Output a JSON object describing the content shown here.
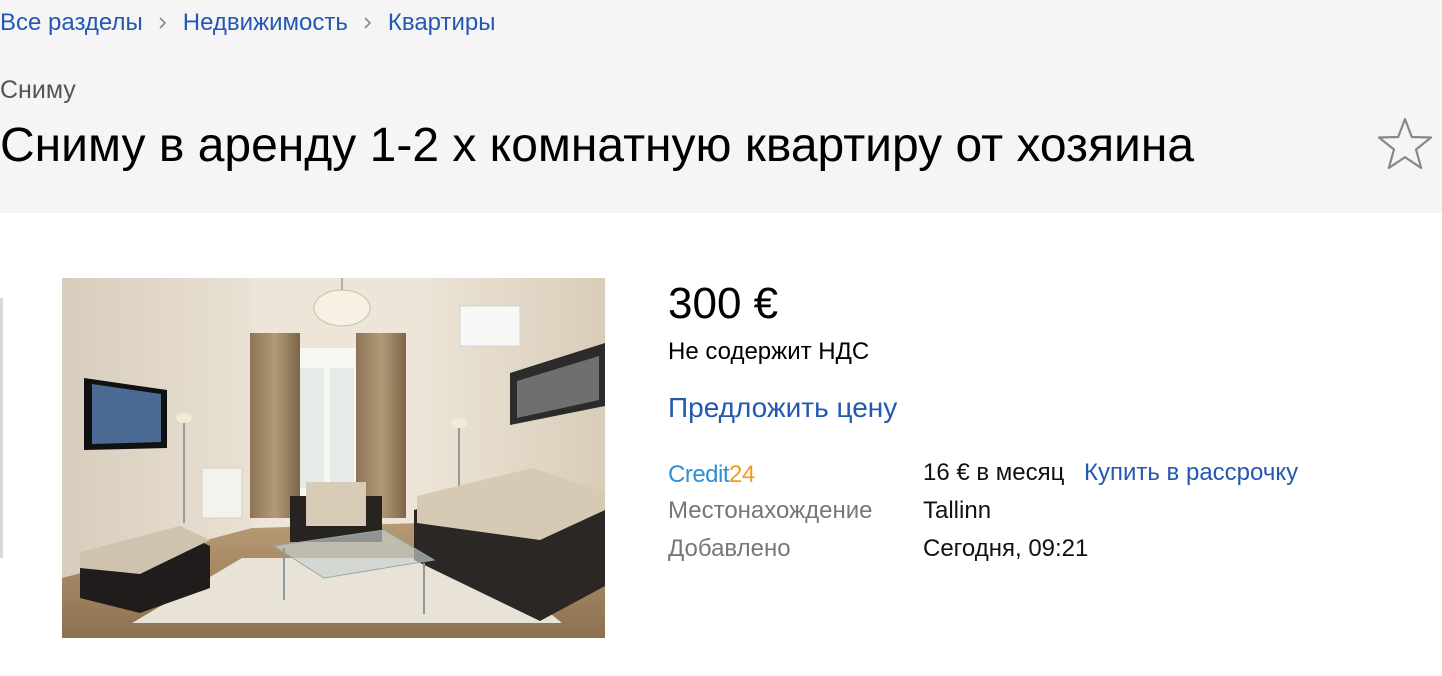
{
  "breadcrumb": [
    "Все разделы",
    "Недвижимость",
    "Квартиры"
  ],
  "category": "Сниму",
  "title": "Сниму в аренду 1-2 х комнатную квартиру от хозяина",
  "price": "300 €",
  "vat_note": "Не содержит НДС",
  "offer_price": "Предложить цену",
  "credit": {
    "logo_text": "Credit24",
    "monthly": "16 € в месяц",
    "buy_link": "Купить в рассрочку"
  },
  "details": [
    {
      "label": "Местонахождение",
      "value": "Tallinn"
    },
    {
      "label": "Добавлено",
      "value": "Сегодня, 09:21"
    }
  ],
  "colors": {
    "link": "#2458b3",
    "header_bg": "#f5f5f5",
    "credit_blue": "#2f8fd3",
    "credit_orange": "#f39a1e"
  },
  "icons": {
    "favorite": "star-outline-icon",
    "separator": "chevron-right-icon"
  }
}
